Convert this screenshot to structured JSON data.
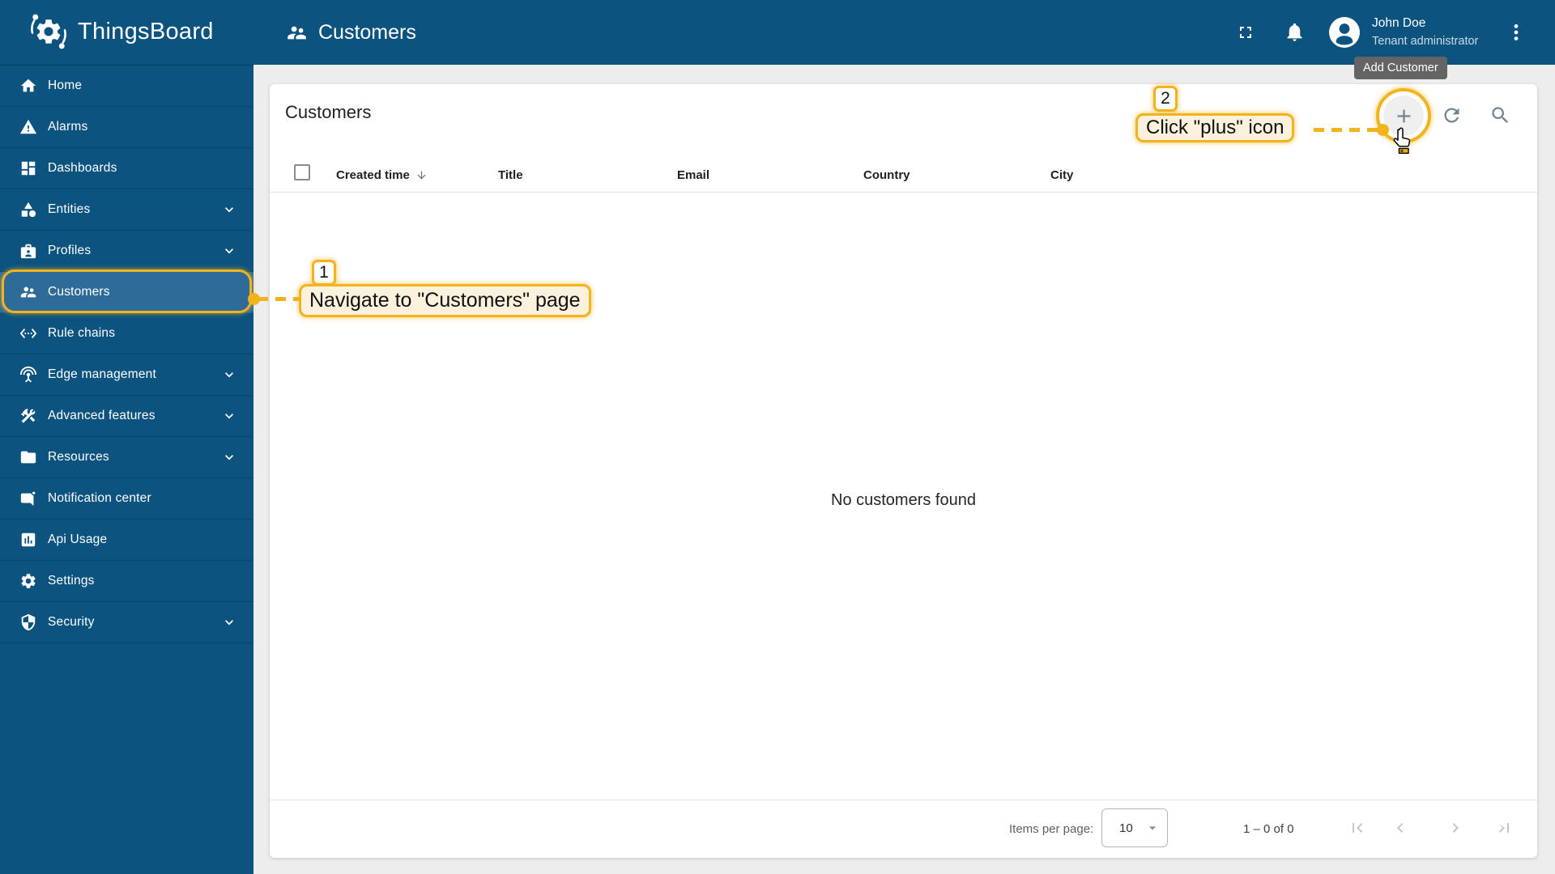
{
  "app": {
    "name": "ThingsBoard"
  },
  "topbar": {
    "title": "Customers",
    "user": {
      "name": "John Doe",
      "role": "Tenant administrator"
    },
    "tooltip": "Add Customer"
  },
  "sidebar": {
    "items": [
      {
        "label": "Home",
        "icon": "home",
        "expandable": false,
        "selected": false
      },
      {
        "label": "Alarms",
        "icon": "warning",
        "expandable": false,
        "selected": false
      },
      {
        "label": "Dashboards",
        "icon": "dashboards",
        "expandable": false,
        "selected": false
      },
      {
        "label": "Entities",
        "icon": "entities",
        "expandable": true,
        "selected": false
      },
      {
        "label": "Profiles",
        "icon": "profiles",
        "expandable": true,
        "selected": false
      },
      {
        "label": "Customers",
        "icon": "customers",
        "expandable": false,
        "selected": true
      },
      {
        "label": "Rule chains",
        "icon": "rule-chains",
        "expandable": false,
        "selected": false
      },
      {
        "label": "Edge management",
        "icon": "edge-management",
        "expandable": true,
        "selected": false
      },
      {
        "label": "Advanced features",
        "icon": "advanced-features",
        "expandable": true,
        "selected": false
      },
      {
        "label": "Resources",
        "icon": "resources",
        "expandable": true,
        "selected": false
      },
      {
        "label": "Notification center",
        "icon": "notification-center",
        "expandable": false,
        "selected": false
      },
      {
        "label": "Api Usage",
        "icon": "api-usage",
        "expandable": false,
        "selected": false
      },
      {
        "label": "Settings",
        "icon": "settings",
        "expandable": false,
        "selected": false
      },
      {
        "label": "Security",
        "icon": "security",
        "expandable": true,
        "selected": false
      }
    ]
  },
  "page": {
    "title": "Customers",
    "table": {
      "columns": [
        "Created time",
        "Title",
        "Email",
        "Country",
        "City"
      ],
      "sorted_column": "Created time",
      "sort_direction": "desc",
      "empty_text": "No customers found"
    },
    "pagination": {
      "items_per_page_label": "Items per page:",
      "page_size": "10",
      "range_label": "1 – 0 of 0"
    }
  },
  "annotations": {
    "step1": {
      "number": "1",
      "label": "Navigate to \"Customers\" page"
    },
    "step2": {
      "number": "2",
      "label": "Click \"plus\" icon"
    }
  },
  "colors": {
    "primary": "#0C5380",
    "selected_item": "#2E6B99",
    "annotation_accent": "#F2B31C",
    "annotation_fill": "#FCF1DC",
    "tooltip_bg": "#646464",
    "toolbar_icon": "#6F8494",
    "disabled_icon": "#C6C6C6"
  }
}
